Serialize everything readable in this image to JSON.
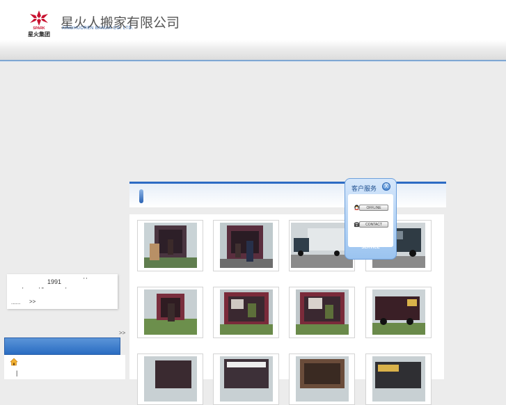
{
  "header": {
    "logo_brand": "SPARK",
    "logo_sub": "星火集团",
    "company_name": "星火人搬家有限公司",
    "company_name_en": "XINGHUOREN BANJIA CO. LTD."
  },
  "intro": {
    "year": "1991",
    "mark1": "' '",
    "mark2": "'",
    "mark3": "' ''",
    "mark4": "'",
    "more": "......",
    "more_arrow": ">>"
  },
  "side_arrow": ">>",
  "menu": {
    "separator": "|",
    "home_icon": "home-icon"
  },
  "service": {
    "title": "客户服务",
    "close": "X",
    "offline": "OFFLINE",
    "contact": "CONTACT",
    "label": "SERVICE"
  },
  "colors": {
    "accent": "#2c6bc4",
    "brand_red": "#c8102e"
  }
}
